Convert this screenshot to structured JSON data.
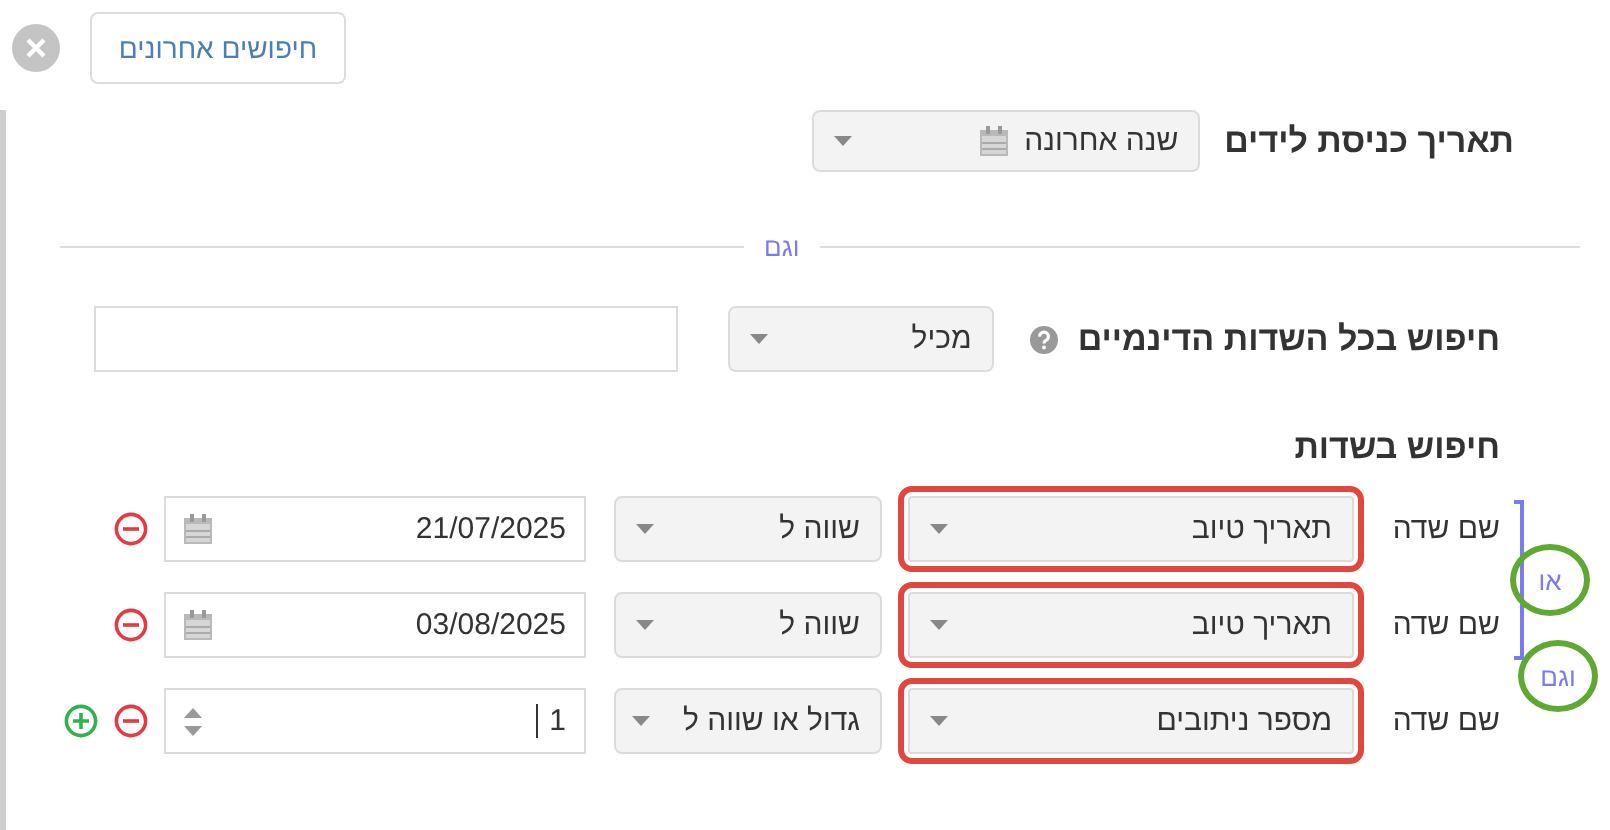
{
  "top_bar": {
    "recent_searches_button": "חיפושים אחרונים"
  },
  "date_filter": {
    "label": "תאריך כניסת לידים",
    "value": "שנה אחרונה"
  },
  "divider_label": "וגם",
  "dynamic_search": {
    "label": "חיפוש בכל השדות הדינמיים",
    "operator": "מכיל"
  },
  "field_search": {
    "heading": "חיפוש בשדות",
    "rows": [
      {
        "label": "שם שדה",
        "field": "תאריך טיוב",
        "highlighted": true,
        "operator": "שווה ל",
        "kind": "date",
        "value": "21/07/2025",
        "add_button": false
      },
      {
        "label": "שם שדה",
        "field": "תאריך טיוב",
        "highlighted": true,
        "operator": "שווה ל",
        "kind": "date",
        "value": "03/08/2025",
        "add_button": false
      },
      {
        "label": "שם שדה",
        "field": "מספר ניתובים",
        "highlighted": true,
        "operator": "גדול או שווה ל",
        "kind": "number",
        "value": "1",
        "add_button": true
      }
    ],
    "connectors": [
      {
        "label": "או",
        "kind": "bracket",
        "circled": true
      },
      {
        "label": "וגם",
        "kind": "plain",
        "circled": true
      }
    ]
  }
}
